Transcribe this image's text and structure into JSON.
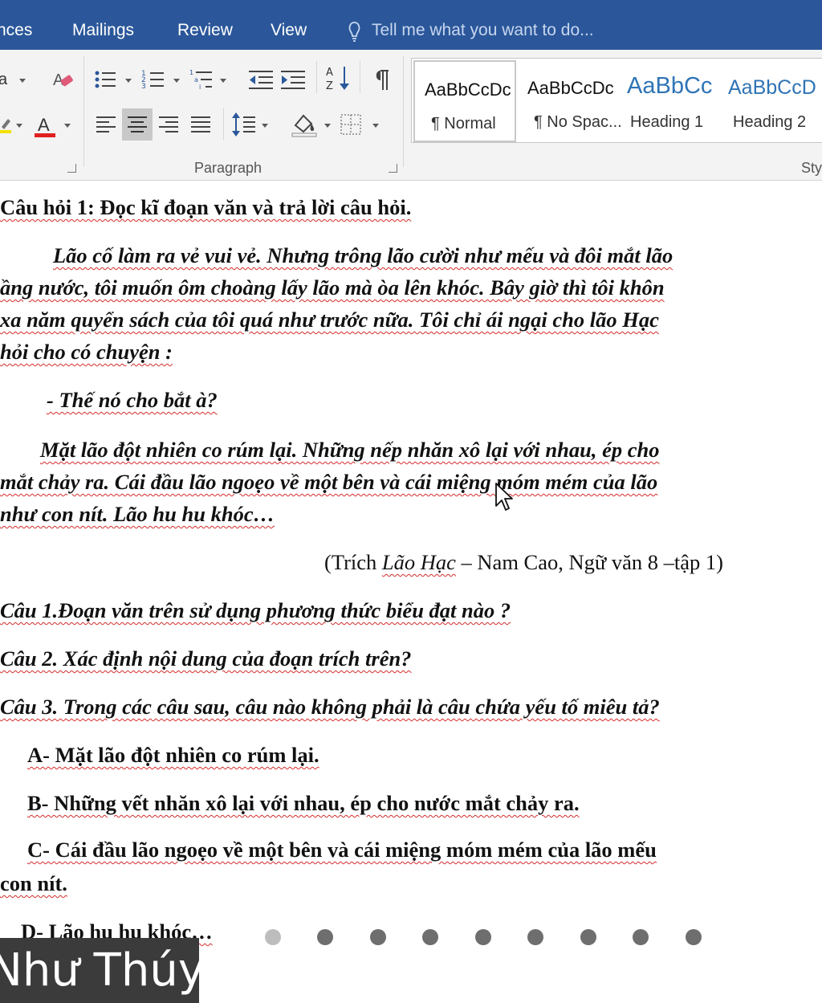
{
  "tabs": {
    "references": "nces",
    "mailings": "Mailings",
    "review": "Review",
    "view": "View",
    "tell_me": "Tell me what you want to do..."
  },
  "ribbon": {
    "font_size_fragment": "a",
    "paragraph_label": "Paragraph",
    "styles_label": "Sty",
    "styles": [
      {
        "preview": "AaBbCcDc",
        "name": "¶ Normal"
      },
      {
        "preview": "AaBbCcDc",
        "name": "¶ No Spac..."
      },
      {
        "preview": "AaBbCc",
        "name": "Heading 1"
      },
      {
        "preview": "AaBbCcD",
        "name": "Heading 2"
      }
    ]
  },
  "document": {
    "q_title": "Câu hỏi 1: Đọc kĩ  đoạn văn và trả lời câu hỏi.",
    "p1_l1": "Lão cố làm ra vẻ vui vẻ. Nhưng trông lão cười như mếu và đôi mắt lão",
    "p1_l2": "ầng nước, tôi muốn ôm choàng lấy lão mà òa lên khóc. Bây giờ thì tôi khôn",
    "p1_l3": "xa năm quyển sách của tôi quá như trước nữa. Tôi chỉ ái ngại cho lão Hạc",
    "p1_l4": "hỏi cho có chuyện :",
    "dialogue": "- Thế nó cho bắt à?",
    "p2_l1": "Mặt lão đột nhiên co rúm lại. Những nếp nhăn xô lại với nhau, ép cho",
    "p2_l2": "mắt chảy ra. Cái đầu lão ngoẹo về một bên và cái miệng móm mém của lão",
    "p2_l3": "như con nít. Lão hu hu khóc…",
    "cite_pre": "(Trích ",
    "cite_title": "Lão Hạc",
    "cite_post": " – Nam Cao, Ngữ văn 8 –tập 1)",
    "q1": "Câu 1.Đoạn văn trên sử dụng phương thức biểu đạt nào ?",
    "q2": "Câu 2. Xác định nội dung của đoạn trích trên?",
    "q3": "Câu 3. Trong các câu sau, câu nào không phải là câu chứa yếu tố miêu tả?",
    "optA": "A-  Mặt lão đột nhiên co rúm lại.",
    "optB": "B- Những vết nhăn xô lại với nhau, ép cho nước mắt chảy ra.",
    "optC_l1": "C- Cái đầu lão ngoẹo về một bên và  cái miệng móm mém của lão mếu",
    "optC_l2": "con nít.",
    "optD": "D- Lão hu hu  khóc…"
  },
  "overlay": {
    "presenter_name": "Như Thúy"
  }
}
